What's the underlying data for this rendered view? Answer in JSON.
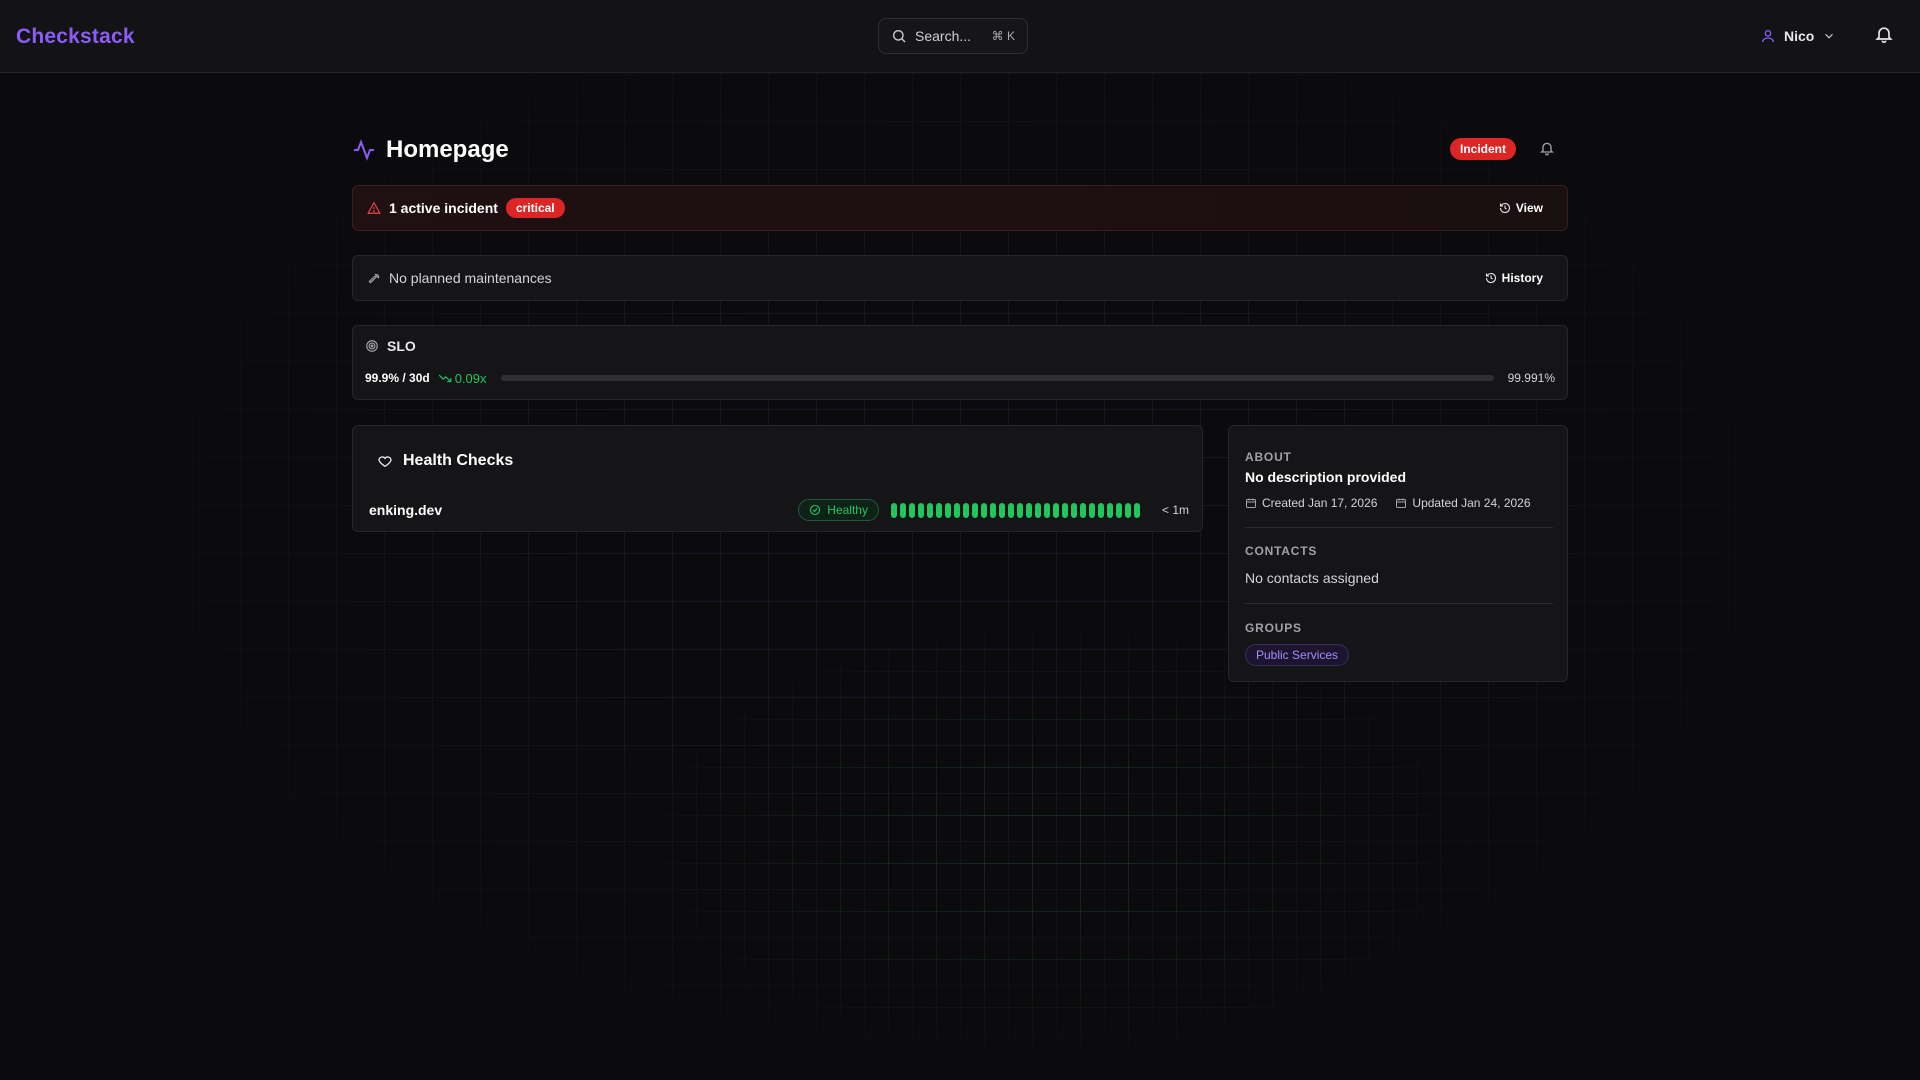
{
  "app": {
    "brand": "Checkstack"
  },
  "topbar": {
    "search_placeholder": "Search...",
    "search_shortcut": "⌘ K",
    "user_name": "Nico",
    "icons": [
      "search-icon",
      "user-icon",
      "chevron-down-icon",
      "bell-icon"
    ]
  },
  "page": {
    "title": "Homepage",
    "status_badge": "Incident",
    "colors": {
      "accent": "#8b5cf6",
      "danger": "#dc2626",
      "success": "#22c55e"
    }
  },
  "incident": {
    "text": "1 active incident",
    "severity": "critical",
    "action_label": "View"
  },
  "maintenance": {
    "text": "No planned maintenances",
    "action_label": "History"
  },
  "slo": {
    "title": "SLO",
    "target": "99.9% / 30d",
    "burn_rate": "0.09x",
    "value": "99.991%"
  },
  "health_checks": {
    "title": "Health Checks",
    "items": [
      {
        "name": "enking.dev",
        "status": "Healthy",
        "history_count": 28,
        "latency": "< 1m"
      }
    ]
  },
  "about": {
    "label": "ABOUT",
    "description": "No description provided",
    "created": "Created Jan 17, 2026",
    "updated": "Updated Jan 24, 2026",
    "contacts_label": "CONTACTS",
    "contacts_text": "No contacts assigned",
    "groups_label": "GROUPS",
    "groups": [
      "Public Services"
    ]
  }
}
